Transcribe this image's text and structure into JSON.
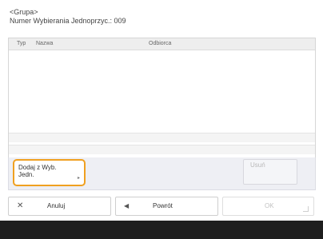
{
  "header": {
    "group": "<Grupa>",
    "number_line": "Numer Wybierania Jednoprzyc.: 009"
  },
  "table": {
    "columns": [
      "Typ",
      "Nazwa",
      "Odbiorca"
    ],
    "rows": []
  },
  "actions": {
    "add_line1": "Dodaj z Wyb.",
    "add_line2": "Jedn.",
    "delete": "Usuń"
  },
  "buttons": {
    "cancel": "Anuluj",
    "back": "Powrót",
    "ok": "OK"
  },
  "icons": {
    "cancel": "close-icon",
    "back": "left-arrow-icon",
    "add": "arrow-right-small-icon"
  }
}
